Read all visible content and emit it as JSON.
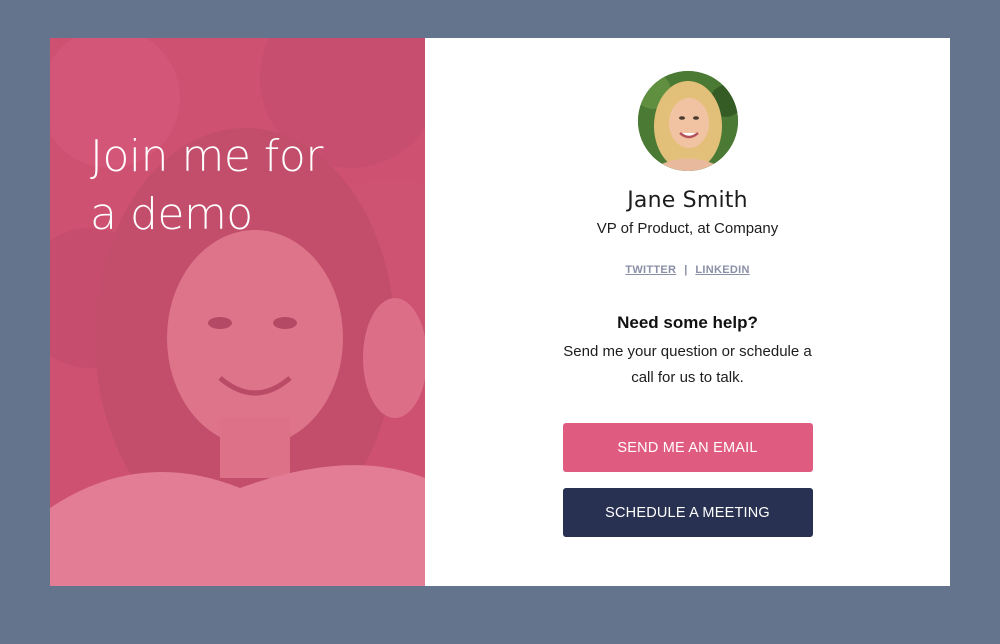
{
  "hero": {
    "heading_line1": "Join me for",
    "heading_line2": "a demo"
  },
  "profile": {
    "name": "Jane Smith",
    "title": "VP of Product, at Company"
  },
  "social": {
    "twitter_label": "TWITTER",
    "separator": "|",
    "linkedin_label": "LINKEDIN"
  },
  "help": {
    "heading": "Need some help?",
    "text": "Send me your question or schedule a call for us to talk."
  },
  "actions": {
    "email_label": "SEND ME AN EMAIL",
    "meeting_label": "SCHEDULE A MEETING"
  },
  "colors": {
    "page_background": "#64748d",
    "hero_overlay": "#e05e82",
    "email_button": "#df5b7f",
    "meeting_button": "#283152"
  }
}
